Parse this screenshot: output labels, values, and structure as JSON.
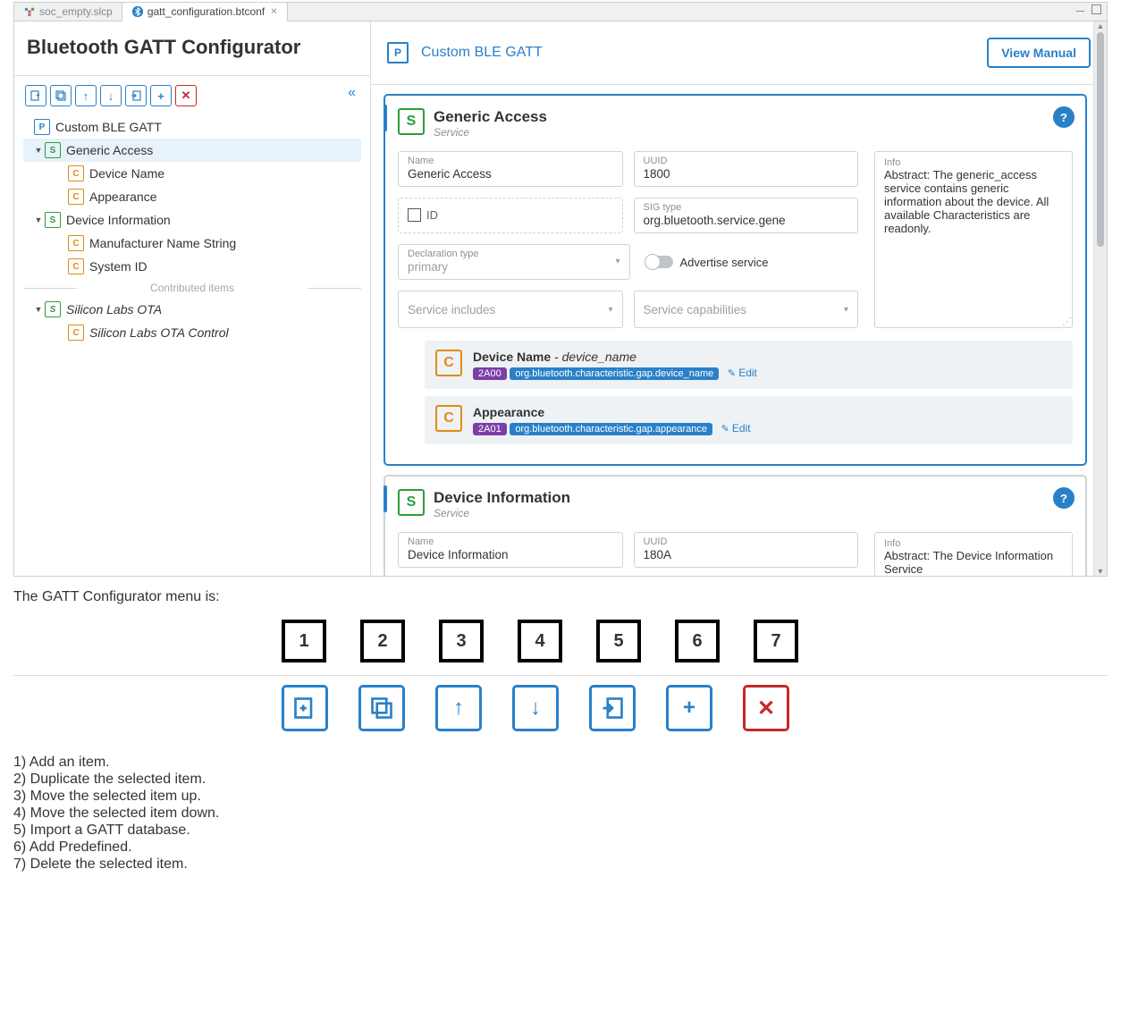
{
  "tabs": [
    {
      "label": "soc_empty.slcp"
    },
    {
      "label": "gatt_configuration.btconf"
    }
  ],
  "sidebar": {
    "title": "Bluetooth GATT Configurator",
    "toolbar": {
      "collapse": "«"
    },
    "tree": {
      "root": "Custom BLE GATT",
      "svc1": {
        "label": "Generic Access",
        "c1": "Device Name",
        "c2": "Appearance"
      },
      "svc2": {
        "label": "Device Information",
        "c1": "Manufacturer Name String",
        "c2": "System ID"
      },
      "contrib": "Contributed items",
      "svc3": {
        "label": "Silicon Labs OTA",
        "c1": "Silicon Labs OTA Control"
      }
    }
  },
  "main": {
    "head": {
      "label": "Custom BLE GATT",
      "button": "View Manual"
    },
    "svc1": {
      "title": "Generic Access",
      "subtitle": "Service",
      "fields": {
        "name": {
          "lab": "Name",
          "val": "Generic Access"
        },
        "uuid": {
          "lab": "UUID",
          "val": "1800"
        },
        "id": {
          "lab": "ID"
        },
        "sig": {
          "lab": "SIG type",
          "val": "org.bluetooth.service.gene"
        },
        "decl": {
          "lab": "Declaration type",
          "val": "primary"
        },
        "adv": "Advertise service",
        "inc": "Service includes",
        "cap": "Service capabilities"
      },
      "info": {
        "lab": "Info",
        "val": "Abstract: The generic_access service contains generic information about the device. All available Characteristics are readonly."
      },
      "chars": [
        {
          "title": "Device Name",
          "sub": " - device_name",
          "pill1": "2A00",
          "pill2": "org.bluetooth.characteristic.gap.device_name",
          "edit": "Edit"
        },
        {
          "title": "Appearance",
          "sub": "",
          "pill1": "2A01",
          "pill2": "org.bluetooth.characteristic.gap.appearance",
          "edit": "Edit"
        }
      ]
    },
    "svc2": {
      "title": "Device Information",
      "subtitle": "Service",
      "fields": {
        "name": {
          "lab": "Name",
          "val": "Device Information"
        },
        "uuid": {
          "lab": "UUID",
          "val": "180A"
        }
      },
      "info": {
        "lab": "Info",
        "val": "Abstract:  The Device Information Service"
      }
    }
  },
  "legend": {
    "heading": "The GATT Configurator menu is:",
    "nums": [
      "1",
      "2",
      "3",
      "4",
      "5",
      "6",
      "7"
    ],
    "desc": [
      "1) Add an item.",
      "2) Duplicate the selected item.",
      "3) Move the selected item up.",
      "4) Move the selected item down.",
      "5) Import a GATT database.",
      "6) Add Predefined.",
      "7) Delete the selected item."
    ]
  }
}
